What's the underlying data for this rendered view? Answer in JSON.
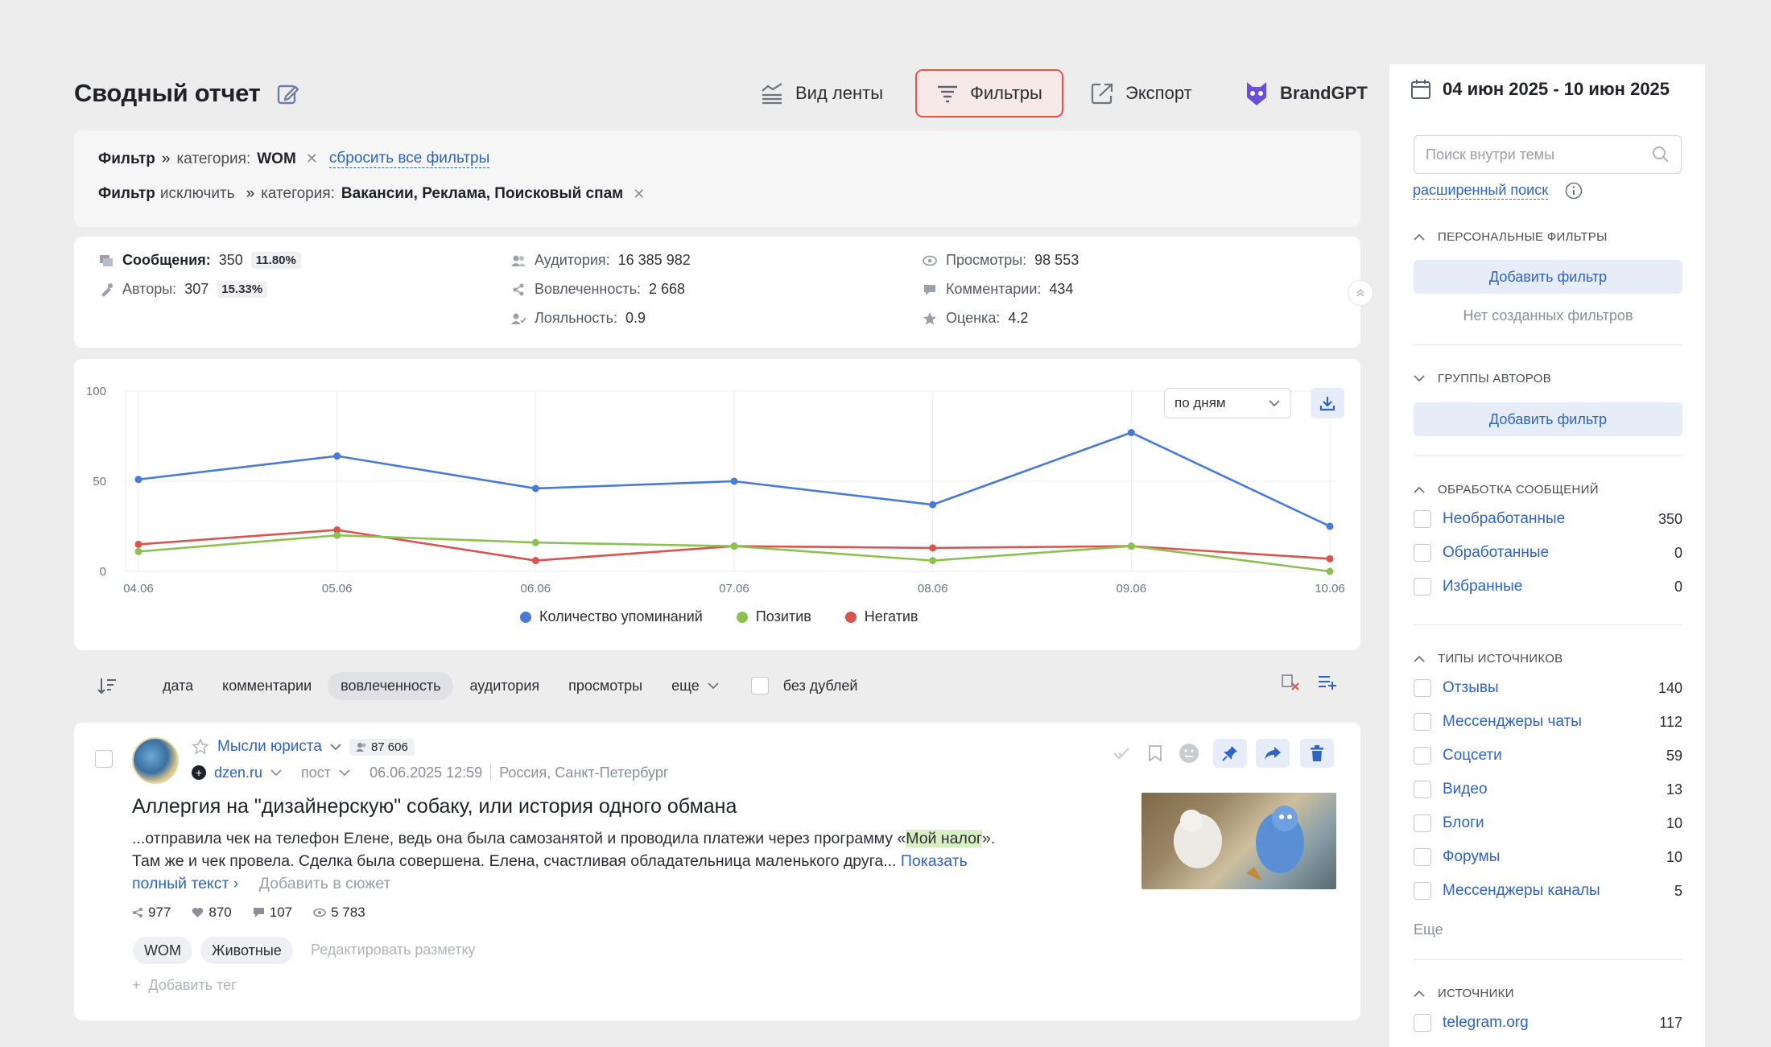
{
  "header": {
    "title": "Сводный отчет",
    "feed_view": "Вид ленты",
    "filters": "Фильтры",
    "export": "Экспорт",
    "brandgpt": "BrandGPT"
  },
  "filter_panel": {
    "row1": {
      "label": "Фильтр",
      "sep": "»",
      "category_label": "категория:",
      "value": "WOM",
      "reset": "сбросить все фильтры"
    },
    "row2": {
      "label": "Фильтр",
      "mode": "исключить",
      "sep": "»",
      "category_label": "категория:",
      "value": "Вакансии, Реклама, Поисковый спам"
    }
  },
  "stats": {
    "messages": {
      "label": "Сообщения:",
      "value": "350",
      "pct": "11.80%"
    },
    "authors": {
      "label": "Авторы:",
      "value": "307",
      "pct": "15.33%"
    },
    "audience": {
      "label": "Аудитория:",
      "value": "16 385 982"
    },
    "engagement": {
      "label": "Вовлеченность:",
      "value": "2 668"
    },
    "loyalty": {
      "label": "Лояльность:",
      "value": "0.9"
    },
    "views": {
      "label": "Просмотры:",
      "value": "98 553"
    },
    "comments": {
      "label": "Комментарии:",
      "value": "434"
    },
    "rating": {
      "label": "Оценка:",
      "value": "4.2"
    }
  },
  "chart_controls": {
    "period_select": "по дням"
  },
  "chart_data": {
    "type": "line",
    "categories": [
      "04.06",
      "05.06",
      "06.06",
      "07.06",
      "08.06",
      "09.06",
      "10.06"
    ],
    "ylim": [
      0,
      100
    ],
    "yticks": [
      "0",
      "50",
      "100"
    ],
    "grid": true,
    "legend": "bottom",
    "series": [
      {
        "name": "Количество упоминаний",
        "color": "#4a7bd4",
        "values": [
          51,
          64,
          46,
          50,
          37,
          77,
          25
        ]
      },
      {
        "name": "Позитив",
        "color": "#8cc152",
        "values": [
          11,
          20,
          16,
          14,
          6,
          14,
          0
        ]
      },
      {
        "name": "Негатив",
        "color": "#d9534f",
        "values": [
          15,
          23,
          6,
          14,
          13,
          14,
          7
        ]
      }
    ]
  },
  "sort_bar": {
    "items": [
      "дата",
      "комментарии",
      "вовлеченность",
      "аудитория",
      "просмотры"
    ],
    "active_index": 2,
    "more": "еще",
    "no_dupes": "без дублей"
  },
  "post": {
    "author": "Мысли юриста",
    "audience": "87 606",
    "source": "dzen.ru",
    "type": "пост",
    "datetime": "06.06.2025 12:59",
    "location": "Россия, Санкт-Петербург",
    "title": "Аллергия на \"дизайнерскую\" собаку, или история одного обмана",
    "text_1": "...отправила чек на телефон Елене, ведь она была самозанятой и проводила платежи через программу «",
    "text_hl": "Мой налог",
    "text_2": "». Там же и чек провела. Сделка была совершена. Елена, счастливая обладательница маленького друга...",
    "show_full": "Показать полный текст ›",
    "add_to_plot": "Добавить в сюжет",
    "metrics": {
      "reposts": "977",
      "likes": "870",
      "comments": "107",
      "views": "5 783"
    },
    "tags": [
      "WOM",
      "Животные"
    ],
    "edit_markup": "Редактировать разметку",
    "add_tag": "Добавить тег"
  },
  "sidebar": {
    "date_range": "04 июн 2025 - 10 июн 2025",
    "search_placeholder": "Поиск внутри темы",
    "advanced_search": "расширенный поиск",
    "personal_filters": {
      "title": "ПЕРСОНАЛЬНЫЕ ФИЛЬТРЫ",
      "add": "Добавить фильтр",
      "empty": "Нет созданных фильтров"
    },
    "author_groups": {
      "title": "ГРУППЫ АВТОРОВ",
      "add": "Добавить фильтр"
    },
    "processing": {
      "title": "ОБРАБОТКА СООБЩЕНИЙ",
      "items": [
        {
          "label": "Необработанные",
          "count": "350"
        },
        {
          "label": "Обработанные",
          "count": "0"
        },
        {
          "label": "Избранные",
          "count": "0"
        }
      ]
    },
    "source_types": {
      "title": "ТИПЫ ИСТОЧНИКОВ",
      "items": [
        {
          "label": "Отзывы",
          "count": "140"
        },
        {
          "label": "Мессенджеры чаты",
          "count": "112"
        },
        {
          "label": "Соцсети",
          "count": "59"
        },
        {
          "label": "Видео",
          "count": "13"
        },
        {
          "label": "Блоги",
          "count": "10"
        },
        {
          "label": "Форумы",
          "count": "10"
        },
        {
          "label": "Мессенджеры каналы",
          "count": "5"
        }
      ],
      "more": "Еще"
    },
    "sources": {
      "title": "ИСТОЧНИКИ",
      "items": [
        {
          "label": "telegram.org",
          "count": "117"
        }
      ]
    }
  }
}
